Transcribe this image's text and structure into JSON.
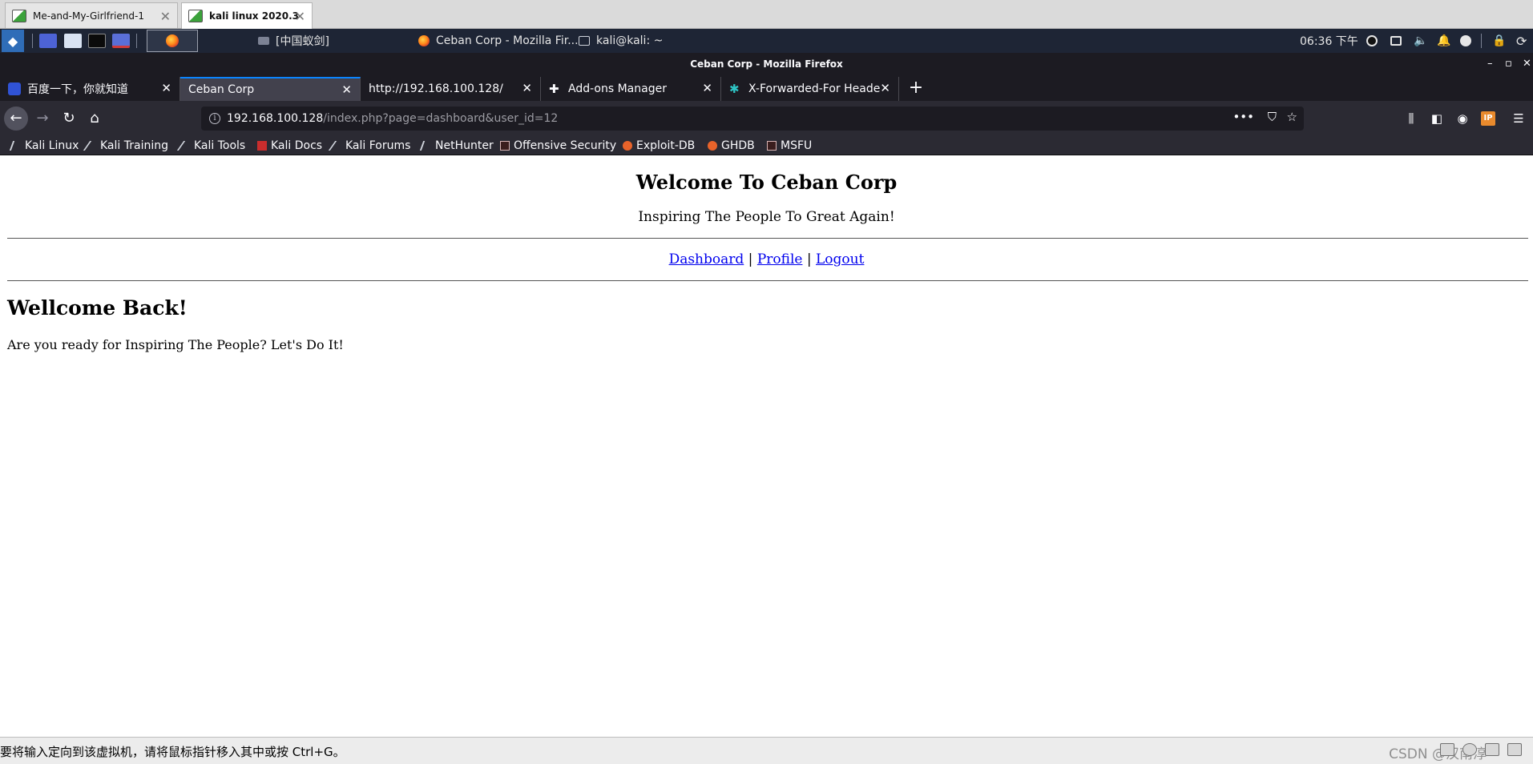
{
  "vmware": {
    "tabs": [
      {
        "label": "Me-and-My-Girlfriend-1"
      },
      {
        "label": "kali linux 2020.3"
      }
    ],
    "status_text": "要将输入定向到该虚拟机，请将鼠标指针移入其中或按 Ctrl+G。",
    "watermark": "CSDN @汉南淳"
  },
  "panel": {
    "tasks": [
      {
        "label": "[中国蚁剑]"
      },
      {
        "label": "Ceban Corp - Mozilla Fir..."
      },
      {
        "label": "kali@kali: ~"
      }
    ],
    "clock": "06:36 下午"
  },
  "firefox": {
    "window_title": "Ceban Corp - Mozilla Firefox",
    "tabs": [
      {
        "label": "百度一下，你就知道"
      },
      {
        "label": "Ceban Corp"
      },
      {
        "label": "http://192.168.100.128/"
      },
      {
        "label": "Add-ons Manager"
      },
      {
        "label": "X-Forwarded-For Heade"
      }
    ],
    "url_host": "192.168.100.128",
    "url_path": "/index.php?page=dashboard&user_id=12",
    "bookmarks": [
      {
        "label": "Kali Linux"
      },
      {
        "label": "Kali Training"
      },
      {
        "label": "Kali Tools"
      },
      {
        "label": "Kali Docs"
      },
      {
        "label": "Kali Forums"
      },
      {
        "label": "NetHunter"
      },
      {
        "label": "Offensive Security"
      },
      {
        "label": "Exploit-DB"
      },
      {
        "label": "GHDB"
      },
      {
        "label": "MSFU"
      }
    ]
  },
  "page": {
    "title": "Welcome To Ceban Corp",
    "tagline": "Inspiring The People To Great Again!",
    "nav": {
      "dashboard": "Dashboard",
      "profile": "Profile",
      "logout": "Logout",
      "separator": "|"
    },
    "heading": "Wellcome Back!",
    "message": "Are you ready for Inspiring The People? Let's Do It!"
  },
  "colors": {
    "link": "#0000ee",
    "accent": "#0a84ff",
    "panel_bg": "#1e2535",
    "ff_dark": "#1c1b22"
  }
}
